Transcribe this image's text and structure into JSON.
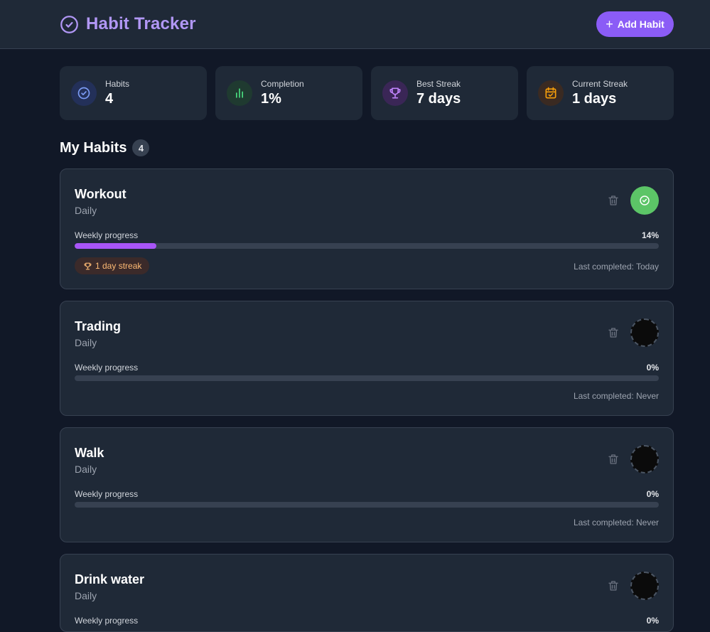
{
  "header": {
    "title": "Habit Tracker",
    "add_label": "Add Habit"
  },
  "stats": [
    {
      "label": "Habits",
      "value": "4",
      "icon": "check-circle-icon"
    },
    {
      "label": "Completion",
      "value": "1%",
      "icon": "bar-chart-icon"
    },
    {
      "label": "Best Streak",
      "value": "7 days",
      "icon": "trophy-icon"
    },
    {
      "label": "Current Streak",
      "value": "1 days",
      "icon": "calendar-check-icon"
    }
  ],
  "section": {
    "title": "My Habits",
    "count": "4"
  },
  "habits": [
    {
      "name": "Workout",
      "frequency": "Daily",
      "progress_label": "Weekly progress",
      "progress_pct": "14%",
      "progress_value": 0.14,
      "streak": "1 day streak",
      "last_completed": "Last completed: Today",
      "completed": true
    },
    {
      "name": "Trading",
      "frequency": "Daily",
      "progress_label": "Weekly progress",
      "progress_pct": "0%",
      "progress_value": 0,
      "last_completed": "Last completed: Never",
      "completed": false
    },
    {
      "name": "Walk",
      "frequency": "Daily",
      "progress_label": "Weekly progress",
      "progress_pct": "0%",
      "progress_value": 0,
      "last_completed": "Last completed: Never",
      "completed": false
    },
    {
      "name": "Drink water",
      "frequency": "Daily",
      "progress_label": "Weekly progress",
      "progress_pct": "0%",
      "progress_value": 0,
      "completed": false
    }
  ],
  "colors": {
    "accent": "#8b5cf6",
    "done": "#5cc567",
    "streak_text": "#fdba74"
  }
}
